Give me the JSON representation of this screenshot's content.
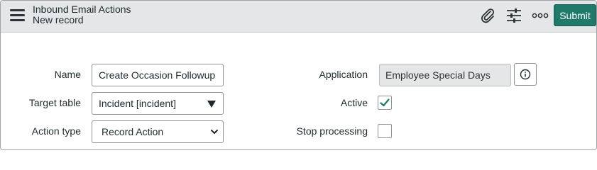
{
  "header": {
    "title": "Inbound Email Actions",
    "subtitle": "New record",
    "submit_label": "Submit",
    "icons": [
      "menu-icon",
      "paperclip-icon",
      "sliders-icon",
      "more-options-icon"
    ]
  },
  "form": {
    "name": {
      "label": "Name",
      "value": "Create Occasion Followup"
    },
    "target_table": {
      "label": "Target table",
      "value": "Incident [incident]"
    },
    "action_type": {
      "label": "Action type",
      "value": "Record Action"
    },
    "application": {
      "label": "Application",
      "value": "Employee Special Days"
    },
    "active": {
      "label": "Active",
      "checked": true
    },
    "stop_processing": {
      "label": "Stop processing",
      "checked": false
    }
  },
  "colors": {
    "accent": "#1f7a6b",
    "header_bg": "#e4e6e7"
  }
}
